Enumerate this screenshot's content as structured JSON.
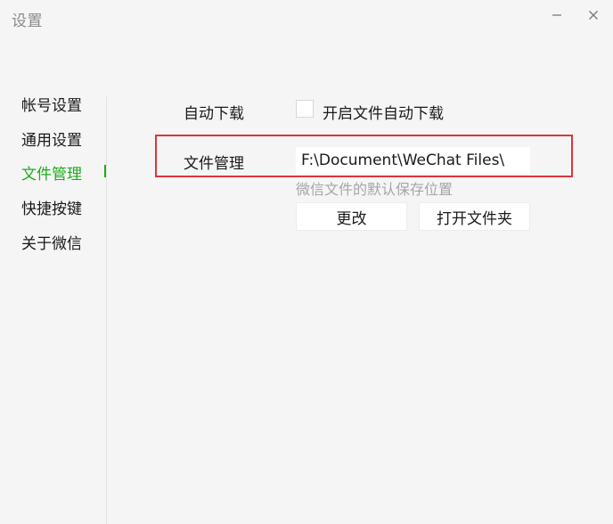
{
  "window": {
    "title": "设置"
  },
  "sidebar": {
    "items": [
      {
        "label": "帐号设置",
        "active": false
      },
      {
        "label": "通用设置",
        "active": false
      },
      {
        "label": "文件管理",
        "active": true
      },
      {
        "label": "快捷按键",
        "active": false
      },
      {
        "label": "关于微信",
        "active": false
      }
    ]
  },
  "settings": {
    "auto_download": {
      "label": "自动下载",
      "checkbox_label": "开启文件自动下载",
      "checked": false
    },
    "file_management": {
      "label": "文件管理",
      "path": "F:\\Document\\WeChat Files\\",
      "hint": "微信文件的默认保存位置",
      "change_button": "更改",
      "open_folder_button": "打开文件夹"
    }
  },
  "colors": {
    "accent": "#1aad19",
    "highlight": "#d9363e",
    "background": "#f5f5f5"
  },
  "icons": {
    "minimize": "minimize-icon",
    "close": "close-icon"
  }
}
